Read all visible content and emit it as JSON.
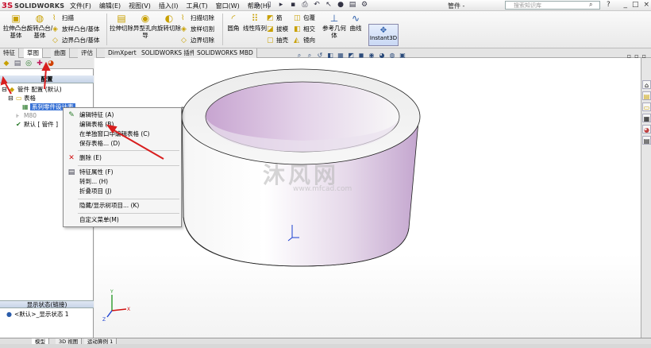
{
  "app": {
    "logo_mark": "3S",
    "logo_text": "SOLIDWORKS",
    "document_title": "管件 -",
    "search_placeholder": "搜索知识库",
    "help_glyph": "?",
    "window_controls": [
      "_",
      "□",
      "×"
    ]
  },
  "menu": [
    "文件(F)",
    "编辑(E)",
    "视图(V)",
    "插入(I)",
    "工具(T)",
    "窗口(W)",
    "帮助(H)"
  ],
  "quick_access": [
    {
      "name": "home-icon",
      "glyph": "⌂"
    },
    {
      "name": "new-icon",
      "glyph": "▯"
    },
    {
      "name": "open-icon",
      "glyph": "▸"
    },
    {
      "name": "save-icon",
      "glyph": "▪"
    },
    {
      "name": "print-icon",
      "glyph": "⎙"
    },
    {
      "name": "undo-icon",
      "glyph": "↶"
    },
    {
      "name": "select-icon",
      "glyph": "↖"
    },
    {
      "name": "rebuild-icon",
      "glyph": "●"
    },
    {
      "name": "file-properties-icon",
      "glyph": "▤"
    },
    {
      "name": "options-icon",
      "glyph": "⚙"
    }
  ],
  "command_manager": {
    "extrude_boss": "拉伸凸台/基体",
    "revolve_boss": "旋转凸台/基体",
    "sweep": "扫描",
    "loft_boss": "放样凸台/基体",
    "boundary_boss": "边界凸台/基体",
    "extrude_cut": "拉伸切除",
    "hole_wizard": "异型孔向导",
    "revolve_cut": "旋转切除",
    "swept_cut": "扫描切除",
    "lofted_cut": "放样切割",
    "boundary_cut": "边界切除",
    "fillet": "圆角",
    "linear_pattern": "线性阵列",
    "rib": "筋",
    "draft": "拔模",
    "shell": "抽壳",
    "wrap": "包覆",
    "intersect": "相交",
    "mirror": "镜向",
    "ref_geometry": "参考几何体",
    "curves": "曲线",
    "instant3d": "Instant3D"
  },
  "tabs": [
    "特征",
    "草图",
    "曲面",
    "评估",
    "DimXpert",
    "SOLIDWORKS 插件",
    "SOLIDWORKS MBD"
  ],
  "feature_manager": {
    "header": "配置",
    "tree": [
      {
        "label": "管件 配置 (默认)"
      },
      {
        "label": "表格"
      },
      {
        "label": "系列零件设计表"
      },
      {
        "label": "M80"
      },
      {
        "label": "默认 [ 管件 ]"
      }
    ],
    "display_state_header": "显示状态(链接)",
    "display_state_item": "<默认>_显示状态 1"
  },
  "context_menu": [
    {
      "label": "编辑特征 (A)",
      "icon": "edit-feature-icon",
      "glyph": "✎",
      "color": "#2a7a2a"
    },
    {
      "label": "编辑表格 (B)",
      "icon": "",
      "glyph": "",
      "color": ""
    },
    {
      "label": "在单独窗口中编辑表格 (C)",
      "icon": "",
      "glyph": "",
      "color": ""
    },
    {
      "label": "保存表格... (D)",
      "icon": "",
      "glyph": "",
      "color": ""
    },
    {
      "label": "删除 (E)",
      "icon": "delete-icon",
      "glyph": "✕",
      "color": "#d01010"
    },
    {
      "label": "特征属性 (F)",
      "icon": "feature-properties-icon",
      "glyph": "▤",
      "color": "#334"
    },
    {
      "label": "转到... (H)",
      "icon": "",
      "glyph": "",
      "color": ""
    },
    {
      "label": "折叠项目 (J)",
      "icon": "",
      "glyph": "",
      "color": ""
    },
    {
      "label": "隐藏/显示树项目... (K)",
      "icon": "",
      "glyph": "",
      "color": ""
    },
    {
      "label": "自定义菜单(M)",
      "icon": "",
      "glyph": "",
      "color": ""
    }
  ],
  "bottom_tabs": [
    "模型",
    "3D 视图",
    "运动算例 1"
  ],
  "watermark": {
    "text": "沐风网",
    "url": "www.mfcad.com"
  },
  "colors": {
    "accent_red": "#d81e1e",
    "selection_blue": "#3b74d6",
    "model_purple": "#c9a9d4"
  }
}
